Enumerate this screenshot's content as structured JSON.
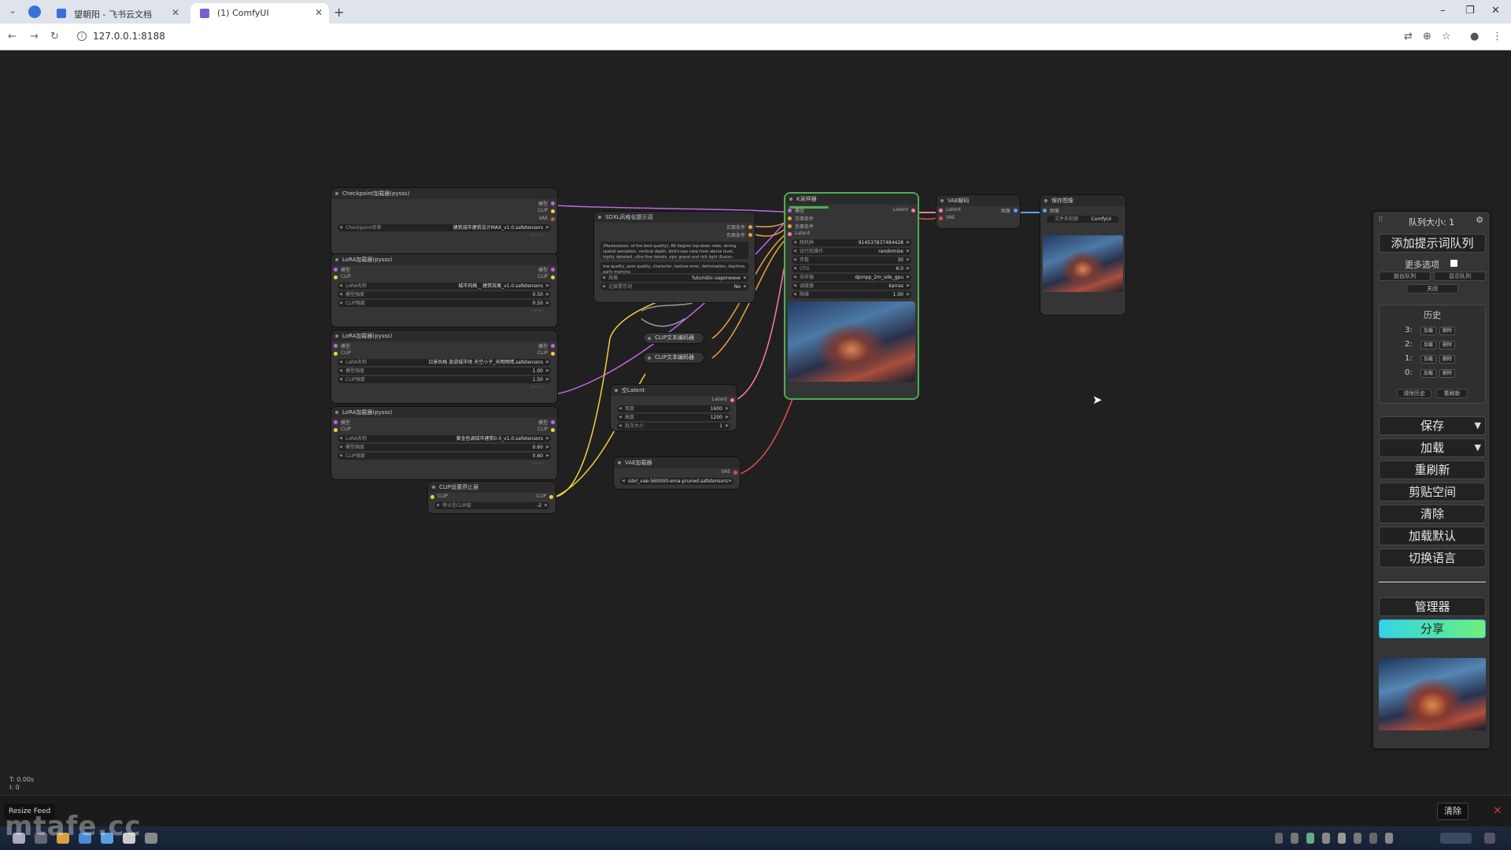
{
  "browser": {
    "tabs": [
      {
        "title": "望朝阳 - 飞书云文档",
        "favicon_color": "#3d6fd8"
      },
      {
        "title": "(1) ComfyUI",
        "favicon_color": "#7b5fd0"
      }
    ],
    "url": "127.0.0.1:8188",
    "win": {
      "min": "–",
      "restore": "❐",
      "close": "✕"
    }
  },
  "nodes": {
    "checkpoint": {
      "title": "Checkpoint加载器(pysss)",
      "outputs": [
        "模型",
        "CLIP",
        "VAE"
      ],
      "widget_label": "Checkpoint名称",
      "widget_value": "建筑城市建筑设计MAX_v1.0.safetensors",
      "placeholder": "[none]"
    },
    "lora1": {
      "title": "LoRA加载器(pysss)",
      "inputs": [
        "模型",
        "CLIP"
      ],
      "outputs": [
        "模型",
        "CLIP"
      ],
      "w1_label": "LoRA名称",
      "w1_value": "城市风格 _ 建筑效果_v1.0.safetensors",
      "w2_label": "模型强度",
      "w2_value": "0.50",
      "w3_label": "CLIP强度",
      "w3_value": "0.50",
      "placeholder": "[none]"
    },
    "lora2": {
      "title": "LoRA加载器(pysss)",
      "inputs": [
        "模型",
        "CLIP"
      ],
      "outputs": [
        "模型",
        "CLIP"
      ],
      "w1_label": "LoRA名称",
      "w1_value": "日景风格 旅游城市场 天空小子_天明明晴.safetensors",
      "w2_label": "模型强度",
      "w2_value": "1.00",
      "w3_label": "CLIP强度",
      "w3_value": "1.50",
      "placeholder": "[none]"
    },
    "lora3": {
      "title": "LoRA加载器(pysss)",
      "inputs": [
        "模型",
        "CLIP"
      ],
      "outputs": [
        "模型",
        "CLIP"
      ],
      "w1_label": "LoRA名称",
      "w1_value": "黄金色调城市建筑0.0_v1.0.safetensors",
      "w2_label": "模型强度",
      "w2_value": "0.60",
      "w3_label": "CLIP强度",
      "w3_value": "0.60",
      "placeholder": "[none]"
    },
    "clipstop": {
      "title": "CLIP设置停止层",
      "input": "CLIP",
      "output": "CLIP",
      "w_label": "停止在CLIP层",
      "w_value": "-2"
    },
    "sdxl": {
      "title": "SDXL风格化提示词",
      "outputs": [
        "正面条件",
        "负面条件"
      ],
      "positive": "(Masterpiece, of the best quality), 8K degree top-down view, strong spatial sensation, vertical depth, bird's-eye view from above level, highly detailed, ultra fine details, epic grand and rich light illusion",
      "negative": "low quality, poor quality, character, texture error, deformation, daytime, early morning",
      "w1_label": "风格",
      "w1_value": "futuristic-vaporwave",
      "w2_label": "记录提示词",
      "w2_value": "No"
    },
    "clipenc1": {
      "title": "CLIP文本编码器"
    },
    "clipenc2": {
      "title": "CLIP文本编码器"
    },
    "latent": {
      "title": "空Latent",
      "output": "Latent",
      "w1_label": "宽度",
      "w1_value": "1600",
      "w2_label": "高度",
      "w2_value": "1200",
      "w3_label": "批次大小",
      "w3_value": "1"
    },
    "vaeloader": {
      "title": "VAE加载器",
      "output": "VAE",
      "w_value": "sdxl_vae-560000-ema-pruned.safetensors"
    },
    "ksampler": {
      "title": "K采样器",
      "inputs": [
        "模型",
        "正面条件",
        "负面条件",
        "Latent"
      ],
      "output": "Latent",
      "widgets": [
        {
          "label": "随机种",
          "value": "914537837484428"
        },
        {
          "label": "运行后操作",
          "value": "randomize"
        },
        {
          "label": "步数",
          "value": "30"
        },
        {
          "label": "CFG",
          "value": "6.0"
        },
        {
          "label": "采样器",
          "value": "dpmpp_2m_sde_gpu"
        },
        {
          "label": "调度器",
          "value": "karras"
        },
        {
          "label": "降噪",
          "value": "1.00"
        }
      ]
    },
    "vaedecode": {
      "title": "VAE解码",
      "inputs": [
        "Latent",
        "VAE"
      ],
      "output": "图像"
    },
    "save": {
      "title": "保存图像",
      "input": "图像",
      "w_label": "文件名前缀",
      "w_value": "ComfyUI"
    }
  },
  "panel": {
    "queue_label": "队列大小: 1",
    "queue_prompt": "添加提示词队列",
    "more_options": "更多选项",
    "front_queue": "前台队列",
    "show_queue": "显示队列",
    "close": "关闭",
    "history_title": "历史",
    "history": [
      {
        "index": "3:",
        "load": "加载",
        "delete": "删除"
      },
      {
        "index": "2:",
        "load": "加载",
        "delete": "删除"
      },
      {
        "index": "1:",
        "load": "加载",
        "delete": "删除"
      },
      {
        "index": "0:",
        "load": "加载",
        "delete": "删除"
      }
    ],
    "clear_history": "清除历史",
    "refresh_small": "重刷新",
    "save": "保存",
    "load": "加载",
    "refresh": "重刷新",
    "clipspace": "剪贴空间",
    "clear": "清除",
    "load_default": "加载默认",
    "switch_lang": "切换语言",
    "manager": "管理器",
    "share": "分享"
  },
  "status": {
    "t": "T: 0.00s",
    "i": "I: 0"
  },
  "bottom": {
    "resize_feed": "Resize Feed",
    "clear": "清除",
    "close": "✕",
    "watermark": "mtafe.cc"
  }
}
